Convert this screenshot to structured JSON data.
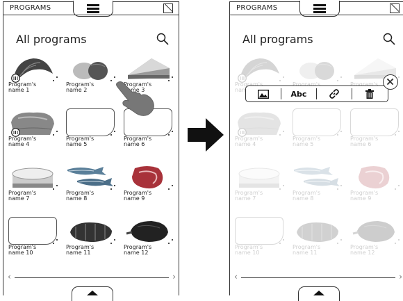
{
  "header": {
    "title": "PROGRAMS"
  },
  "page_title": "All programs",
  "programs": [
    {
      "label": "Program's\nname 1",
      "image": "croissant"
    },
    {
      "label": "Program's\nname 2",
      "image": "bread-rolls"
    },
    {
      "label": "Program's\nname 3",
      "image": "cake-slice"
    },
    {
      "label": "Program's\nname 4",
      "image": "bread-loaf"
    },
    {
      "label": "Program's\nname 5",
      "image": "empty"
    },
    {
      "label": "Program's\nname 6",
      "image": "empty"
    },
    {
      "label": "Program's\nname 7",
      "image": "cheesecake"
    },
    {
      "label": "Program's\nname 8",
      "image": "fish"
    },
    {
      "label": "Program's\nname 9",
      "image": "steak"
    },
    {
      "label": "Program's\nname 10",
      "image": "empty"
    },
    {
      "label": "Program's\nname 11",
      "image": "roast-meat"
    },
    {
      "label": "Program's\nname 12",
      "image": "roast-beef"
    }
  ],
  "edit_toolbar": {
    "text_button": "Abc"
  },
  "icons": [
    "menu-icon",
    "tablet-icon",
    "search-icon",
    "chevron-left-icon",
    "chevron-right-icon",
    "triangle-up-icon",
    "image-icon",
    "link-icon",
    "trash-icon",
    "close-icon",
    "tap-hand-icon",
    "arrow-right-icon"
  ]
}
